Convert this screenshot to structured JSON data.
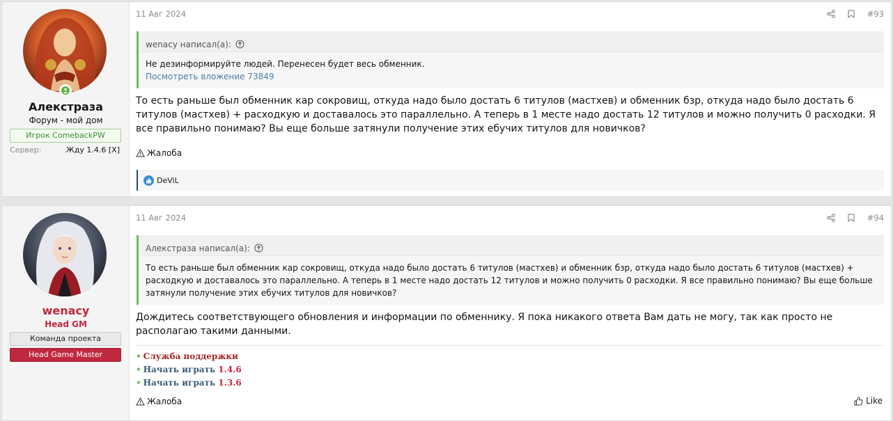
{
  "posts": [
    {
      "user": {
        "name": "Алекстраза",
        "title": "Форум - мой дом",
        "banner": "Игрок ComebackPW",
        "extra_key": "Сервер:",
        "extra_value": "Жду 1.4.6 [X]"
      },
      "date": "11 Авг 2024",
      "number": "#93",
      "quote": {
        "author": "wenacy написал(а):",
        "text": "Не дезинформируйте людей. Перенесен будет весь обменник.",
        "link": "Посмотреть вложение 73849"
      },
      "message": "То есть раньше был обменник кар сокровищ, откуда надо было достать 6 титулов (мастхев) и обменник бзр, откуда надо было достать 6 титулов (мастхев) + расходкую и доставалось это параллельно. А теперь в 1 месте надо достать 12 титулов и можно получить 0 расходки. Я все правильно понимаю? Вы еще больше затянули получение этих ебучих титулов для новичков?",
      "report_label": "Жалоба",
      "reactions": "DeViL"
    },
    {
      "user": {
        "name": "wenacy",
        "title": "Head GM",
        "banner1": "Команда проекта",
        "banner2": "Head Game Master"
      },
      "date": "11 Авг 2024",
      "number": "#94",
      "quote": {
        "author": "Алекстраза написал(а):",
        "text": "То есть раньше был обменник кар сокровищ, откуда надо было достать 6 титулов (мастхев) и обменник бзр, откуда надо было достать 6 титулов (мастхев) + расходкую и доставалось это параллельно. А теперь в 1 месте надо достать 12 титулов и можно получить 0 расходки. Я все правильно понимаю? Вы еще больше затянули получение этих ебучих титулов для новичков?"
      },
      "message": "Дождитесь соответствующего обновления и информации по обменнику. Я пока никакого ответа Вам дать не могу, так как просто не располагаю такими данными.",
      "signature": {
        "support": "Служба поддержки",
        "play_prefix": "Начать играть",
        "play_146": "1.4.6",
        "play_136": "1.3.6"
      },
      "report_label": "Жалоба",
      "like_label": "Like"
    }
  ],
  "colors": {
    "quote_border": "#6cbc5b",
    "username_red": "#c0283f",
    "link": "#4d7ea8",
    "banner_red": "#c0283f"
  },
  "icons": [
    "share-icon",
    "bookmark-icon",
    "arrow-up-circle-icon",
    "warning-icon",
    "like-reaction-icon",
    "thumbs-up-icon",
    "online-status-icon"
  ]
}
